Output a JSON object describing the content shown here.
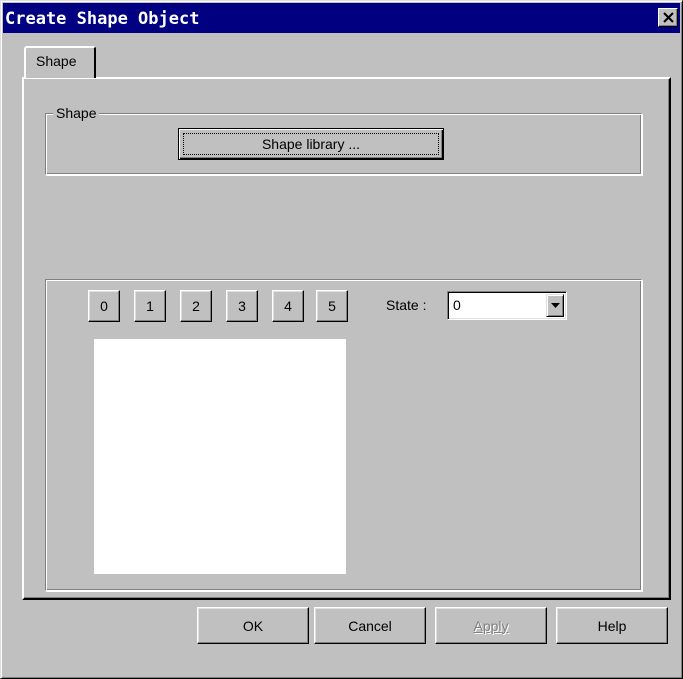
{
  "window": {
    "title": "Create Shape Object",
    "close_icon": "close-x-icon"
  },
  "tabs": [
    {
      "label": "Shape",
      "active": true
    }
  ],
  "shape_group": {
    "title": "Shape",
    "library_button": "Shape library ..."
  },
  "preview": {
    "state_buttons": [
      "0",
      "1",
      "2",
      "3",
      "4",
      "5"
    ],
    "state_label": "State :",
    "state_value": "0",
    "dropdown_icon": "chevron-down-icon"
  },
  "footer": {
    "ok": "OK",
    "cancel": "Cancel",
    "apply": "Apply",
    "help": "Help"
  },
  "colors": {
    "titlebar": "#000080",
    "face": "#c0c0c0",
    "disabled_text": "#808080"
  }
}
